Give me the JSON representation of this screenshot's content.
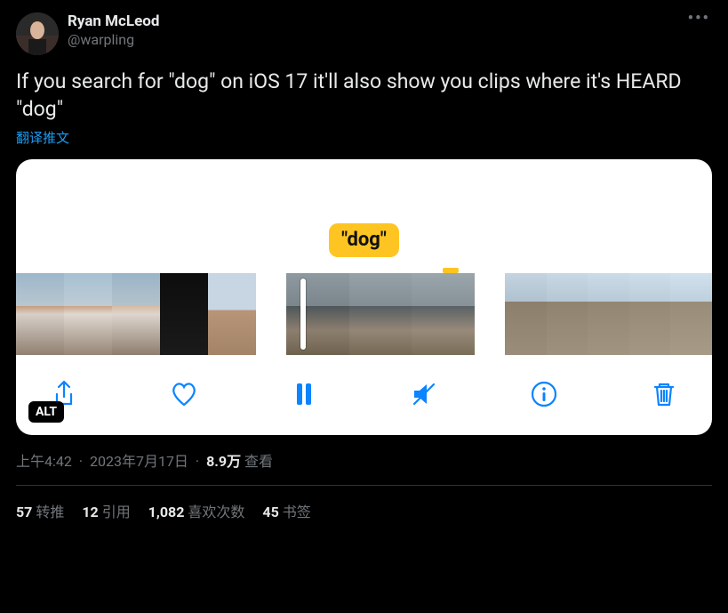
{
  "author": {
    "display_name": "Ryan McLeod",
    "handle": "@warpling"
  },
  "tweet_text": "If you search for \"dog\" on iOS 17 it'll also show you clips where it's HEARD \"dog\"",
  "translate_label": "翻译推文",
  "media": {
    "bubble_text": "\"dog\"",
    "alt_badge": "ALT",
    "controls": {
      "share": "share-icon",
      "like": "heart-icon",
      "play_pause": "pause-icon",
      "mute": "mute-icon",
      "info": "info-icon",
      "delete": "trash-icon"
    }
  },
  "meta": {
    "time": "上午4:42",
    "date": "2023年7月17日",
    "view_count": "8.9万",
    "view_label": "查看"
  },
  "stats": {
    "retweets_count": "57",
    "retweets_label": "转推",
    "quotes_count": "12",
    "quotes_label": "引用",
    "likes_count": "1,082",
    "likes_label": "喜欢次数",
    "bookmarks_count": "45",
    "bookmarks_label": "书签"
  }
}
